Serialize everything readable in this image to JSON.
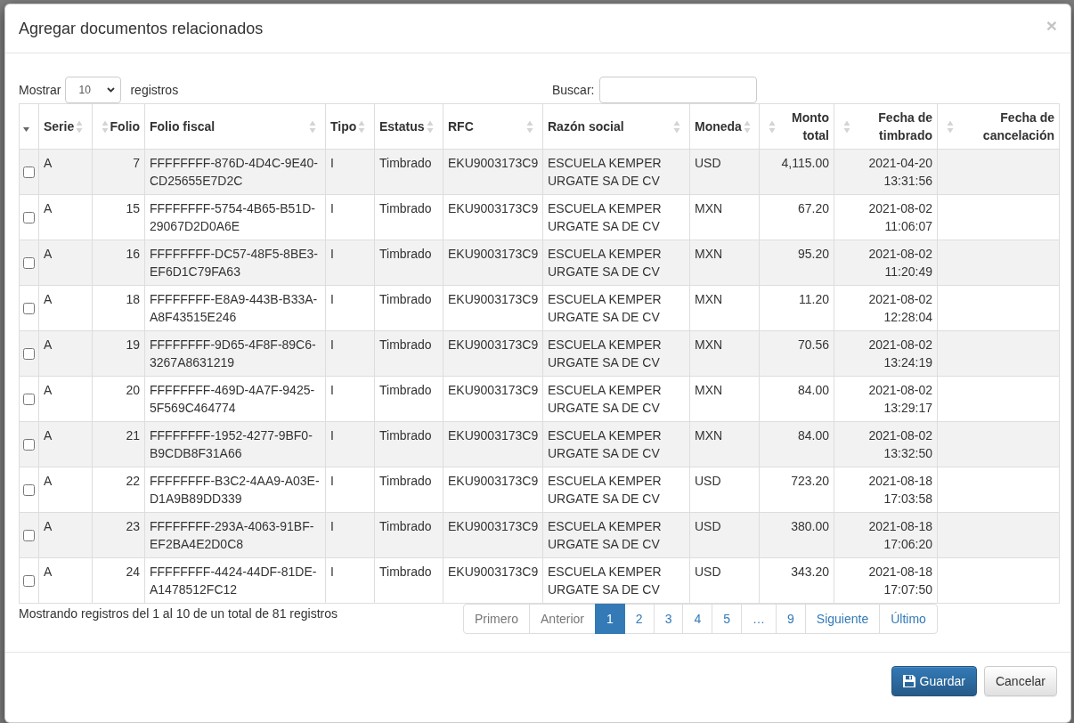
{
  "modal": {
    "title": "Agregar documentos relacionados",
    "close": "×"
  },
  "length_menu": {
    "label": "Mostrar",
    "value": "10",
    "suffix": "registros"
  },
  "search": {
    "label": "Buscar:"
  },
  "table": {
    "select_column": {
      "sorted": true
    },
    "columns": [
      {
        "label": "Serie",
        "kind": "text",
        "sorted": false
      },
      {
        "label": "Folio",
        "kind": "number",
        "sorted": false
      },
      {
        "label": "Folio fiscal",
        "kind": "text",
        "sorted": false
      },
      {
        "label": "Tipo",
        "kind": "text",
        "sorted": false
      },
      {
        "label": "Estatus",
        "kind": "text",
        "sorted": false
      },
      {
        "label": "RFC",
        "kind": "text",
        "sorted": false
      },
      {
        "label": "Razón social",
        "kind": "text",
        "sorted": false
      },
      {
        "label": "Moneda",
        "kind": "text",
        "sorted": false
      },
      {
        "label": "Monto total",
        "kind": "number",
        "sorted": false
      },
      {
        "label": "Fecha de timbrado",
        "kind": "date",
        "sorted": false
      },
      {
        "label": "Fecha de cancelación",
        "kind": "date",
        "sorted": false
      }
    ],
    "rows": [
      {
        "checked": false,
        "cells": [
          "A",
          "7",
          "FFFFFFFF-876D-4D4C-9E40-CD25655E7D2C",
          "I",
          "Timbrado",
          "EKU9003173C9",
          "ESCUELA KEMPER URGATE SA DE CV",
          "USD",
          "4,115.00",
          "2021-04-20 13:31:56"
        ]
      },
      {
        "checked": false,
        "cells": [
          "A",
          "15",
          "FFFFFFFF-5754-4B65-B51D-29067D2D0A6E",
          "I",
          "Timbrado",
          "EKU9003173C9",
          "ESCUELA KEMPER URGATE SA DE CV",
          "MXN",
          "67.20",
          "2021-08-02 11:06:07"
        ]
      },
      {
        "checked": false,
        "cells": [
          "A",
          "16",
          "FFFFFFFF-DC57-48F5-8BE3-EF6D1C79FA63",
          "I",
          "Timbrado",
          "EKU9003173C9",
          "ESCUELA KEMPER URGATE SA DE CV",
          "MXN",
          "95.20",
          "2021-08-02 11:20:49"
        ]
      },
      {
        "checked": false,
        "cells": [
          "A",
          "18",
          "FFFFFFFF-E8A9-443B-B33A-A8F43515E246",
          "I",
          "Timbrado",
          "EKU9003173C9",
          "ESCUELA KEMPER URGATE SA DE CV",
          "MXN",
          "11.20",
          "2021-08-02 12:28:04"
        ]
      },
      {
        "checked": false,
        "cells": [
          "A",
          "19",
          "FFFFFFFF-9D65-4F8F-89C6-3267A8631219",
          "I",
          "Timbrado",
          "EKU9003173C9",
          "ESCUELA KEMPER URGATE SA DE CV",
          "MXN",
          "70.56",
          "2021-08-02 13:24:19"
        ]
      },
      {
        "checked": false,
        "cells": [
          "A",
          "20",
          "FFFFFFFF-469D-4A7F-9425-5F569C464774",
          "I",
          "Timbrado",
          "EKU9003173C9",
          "ESCUELA KEMPER URGATE SA DE CV",
          "MXN",
          "84.00",
          "2021-08-02 13:29:17"
        ]
      },
      {
        "checked": false,
        "cells": [
          "A",
          "21",
          "FFFFFFFF-1952-4277-9BF0-B9CDB8F31A66",
          "I",
          "Timbrado",
          "EKU9003173C9",
          "ESCUELA KEMPER URGATE SA DE CV",
          "MXN",
          "84.00",
          "2021-08-02 13:32:50"
        ]
      },
      {
        "checked": false,
        "cells": [
          "A",
          "22",
          "FFFFFFFF-B3C2-4AA9-A03E-D1A9B89DD339",
          "I",
          "Timbrado",
          "EKU9003173C9",
          "ESCUELA KEMPER URGATE SA DE CV",
          "USD",
          "723.20",
          "2021-08-18 17:03:58"
        ]
      },
      {
        "checked": false,
        "cells": [
          "A",
          "23",
          "FFFFFFFF-293A-4063-91BF-EF2BA4E2D0C8",
          "I",
          "Timbrado",
          "EKU9003173C9",
          "ESCUELA KEMPER URGATE SA DE CV",
          "USD",
          "380.00",
          "2021-08-18 17:06:20"
        ]
      },
      {
        "checked": false,
        "cells": [
          "A",
          "24",
          "FFFFFFFF-4424-44DF-81DE-A1478512FC12",
          "I",
          "Timbrado",
          "EKU9003173C9",
          "ESCUELA KEMPER URGATE SA DE CV",
          "USD",
          "343.20",
          "2021-08-18 17:07:50"
        ]
      }
    ]
  },
  "info": "Mostrando registros del 1 al 10 de un total de 81 registros",
  "pagination": [
    {
      "label": "Primero",
      "disabled": true,
      "selected": false
    },
    {
      "label": "Anterior",
      "disabled": true,
      "selected": false
    },
    {
      "label": "1",
      "disabled": false,
      "selected": true
    },
    {
      "label": "2",
      "disabled": false,
      "selected": false
    },
    {
      "label": "3",
      "disabled": false,
      "selected": false
    },
    {
      "label": "4",
      "disabled": false,
      "selected": false
    },
    {
      "label": "5",
      "disabled": false,
      "selected": false
    },
    {
      "label": "…",
      "disabled": false,
      "selected": false
    },
    {
      "label": "9",
      "disabled": false,
      "selected": false
    },
    {
      "label": "Siguiente",
      "disabled": false,
      "selected": false
    },
    {
      "label": "Último",
      "disabled": false,
      "selected": false
    }
  ],
  "footer": {
    "buttons": [
      {
        "label": "Guardar",
        "kind": "primary"
      },
      {
        "label": "Cancelar",
        "kind": "default"
      }
    ]
  }
}
